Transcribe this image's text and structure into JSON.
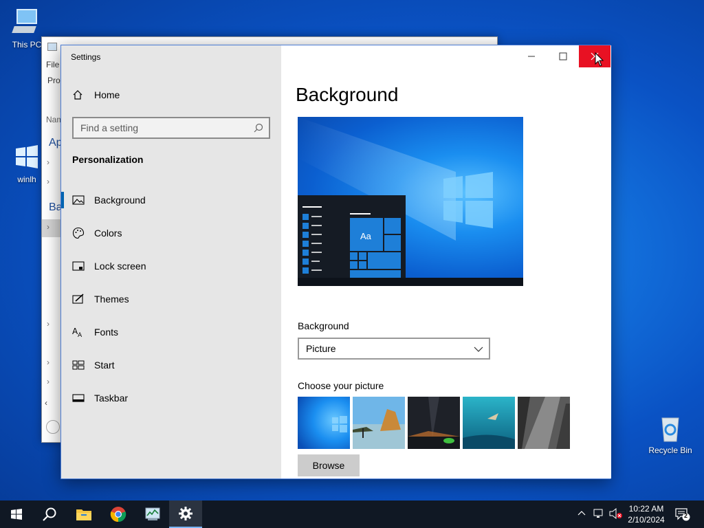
{
  "desktop": {
    "icons": [
      {
        "label": "This PC"
      },
      {
        "label": "winlh"
      },
      {
        "label": "Recycle Bin"
      }
    ]
  },
  "explorer": {
    "menu_file": "File",
    "row_pro": "Pro",
    "row_nam": "Nam",
    "row_ap": "Ap",
    "row_ba": "Ba"
  },
  "settings": {
    "window_title": "Settings",
    "home_label": "Home",
    "search_placeholder": "Find a setting",
    "section_title": "Personalization",
    "nav": [
      {
        "label": "Background",
        "icon": "picture-icon"
      },
      {
        "label": "Colors",
        "icon": "palette-icon"
      },
      {
        "label": "Lock screen",
        "icon": "lock-screen-icon"
      },
      {
        "label": "Themes",
        "icon": "themes-icon"
      },
      {
        "label": "Fonts",
        "icon": "fonts-icon"
      },
      {
        "label": "Start",
        "icon": "start-icon"
      },
      {
        "label": "Taskbar",
        "icon": "taskbar-icon"
      }
    ],
    "page_title": "Background",
    "preview_tile_text": "Aa",
    "background_label": "Background",
    "background_value": "Picture",
    "choose_picture_label": "Choose your picture",
    "browse_label": "Browse",
    "accent_color": "#0063b1",
    "close_color": "#e81123"
  },
  "taskbar": {
    "time": "10:22 AM",
    "date": "2/10/2024",
    "notification_count": "2"
  }
}
